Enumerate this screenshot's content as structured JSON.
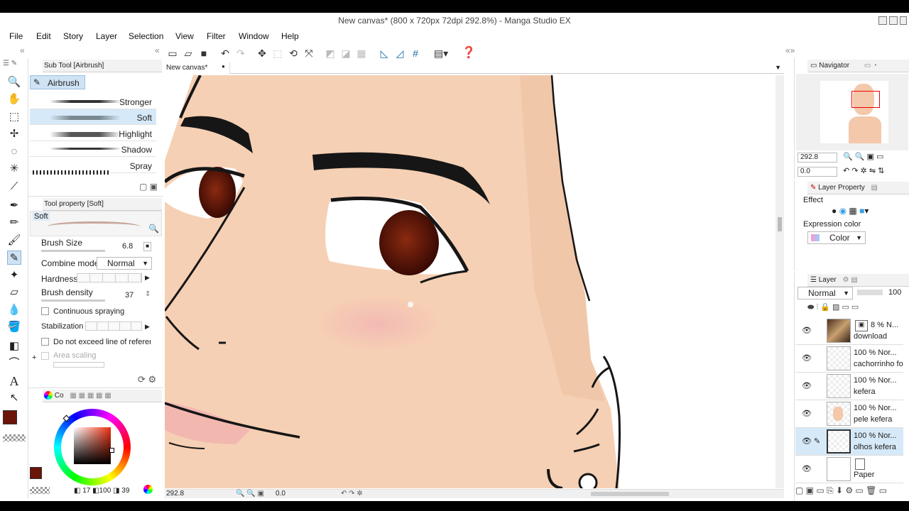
{
  "window": {
    "title": "New canvas* (800 x 720px 72dpi 292.8%)  - Manga Studio EX"
  },
  "menu": [
    "File",
    "Edit",
    "Story",
    "Layer",
    "Selection",
    "View",
    "Filter",
    "Window",
    "Help"
  ],
  "canvas_tab": {
    "label": "New canvas*",
    "dot": "●"
  },
  "subtool": {
    "header": "Sub Tool [Airbrush]",
    "group": "Airbrush",
    "brushes": [
      "Stronger",
      "Soft",
      "Highlight",
      "Shadow",
      "Spray"
    ],
    "selected": "Soft"
  },
  "tool_property": {
    "header": "Tool property [Soft]",
    "preview_label": "Soft",
    "brush_size_label": "Brush Size",
    "brush_size_value": "6.8",
    "combine_mode_label": "Combine mode",
    "combine_mode_value": "Normal",
    "hardness_label": "Hardness",
    "brush_density_label": "Brush density",
    "brush_density_value": "37",
    "continuous_spraying_label": "Continuous spraying",
    "stabilization_label": "Stabilization",
    "not_exceed_label": "Do not exceed line of referen",
    "area_scaling_label": "Area scaling",
    "plus": "+"
  },
  "color": {
    "tab_label": "Co",
    "main_color": "#6b1408",
    "values": {
      "a": "17",
      "b": "100",
      "c": "39"
    }
  },
  "navigator": {
    "header": "Navigator",
    "zoom": "292.8",
    "rotate": "0.0"
  },
  "layer_property": {
    "header": "Layer Property",
    "effect_label": "Effect",
    "expression_color_label": "Expression color",
    "expression_color_value": "Color"
  },
  "layers": {
    "header": "Layer",
    "blend_mode": "Normal",
    "opacity": "100",
    "items": [
      {
        "opacity": "8 %",
        "mode": "N...",
        "name": "download"
      },
      {
        "opacity": "100 %",
        "mode": "Nor...",
        "name": "cachorrinho fo"
      },
      {
        "opacity": "100 %",
        "mode": "Nor...",
        "name": "kefera"
      },
      {
        "opacity": "100 %",
        "mode": "Nor...",
        "name": "pele kefera"
      },
      {
        "opacity": "100 %",
        "mode": "Nor...",
        "name": "olhos kefera"
      },
      {
        "opacity": "",
        "mode": "",
        "name": "Paper"
      }
    ]
  },
  "status": {
    "zoom": "292.8",
    "angle": "0.0"
  },
  "colors": {
    "skin": "#f6d0b4",
    "skin_dark": "#ebbd9d",
    "lip": "#f2b8b0",
    "iris": "#5a1408",
    "line": "#161616",
    "selection_blue": "#d6e9f8"
  }
}
